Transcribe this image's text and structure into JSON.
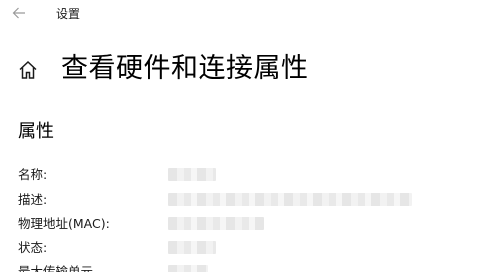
{
  "window": {
    "app_title": "设置",
    "back_icon": "back-arrow-icon"
  },
  "header": {
    "home_icon": "home-icon",
    "title": "查看硬件和连接属性"
  },
  "section": {
    "title": "属性"
  },
  "properties": [
    {
      "label": "名称:"
    },
    {
      "label": "描述:"
    },
    {
      "label": "物理地址(MAC):"
    },
    {
      "label": "状态:"
    },
    {
      "label": "最大传输单元"
    }
  ]
}
